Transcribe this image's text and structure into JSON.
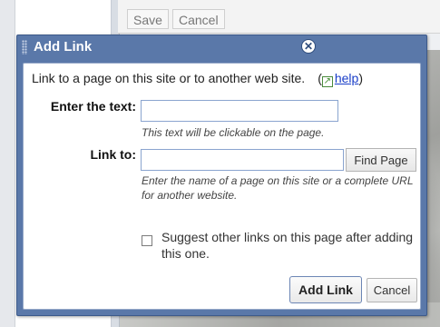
{
  "toolbar": {
    "save_label": "Save",
    "cancel_label": "Cancel"
  },
  "dialog": {
    "title": "Add Link",
    "close_icon": "close-circle-icon",
    "intro": "Link to a page on this site or to another web site.",
    "help_icon": "help-arrow-icon",
    "help_paren_open": "(",
    "help_link": "help",
    "help_paren_close": ")",
    "text_field": {
      "label": "Enter the text:",
      "value": "",
      "hint": "This text will be clickable on the page."
    },
    "link_field": {
      "label": "Link to:",
      "value": "",
      "find_button": "Find Page",
      "hint": "Enter the name of a page on this site or a complete URL for another website."
    },
    "suggest": {
      "checked": false,
      "label": "Suggest other links on this page after adding this one."
    },
    "add_button": "Add Link",
    "cancel_button": "Cancel"
  },
  "colors": {
    "dialog_frame": "#5a78a9",
    "title_text": "#ffffff",
    "link": "#1a3ec8",
    "input_border": "#8aa4cf"
  }
}
